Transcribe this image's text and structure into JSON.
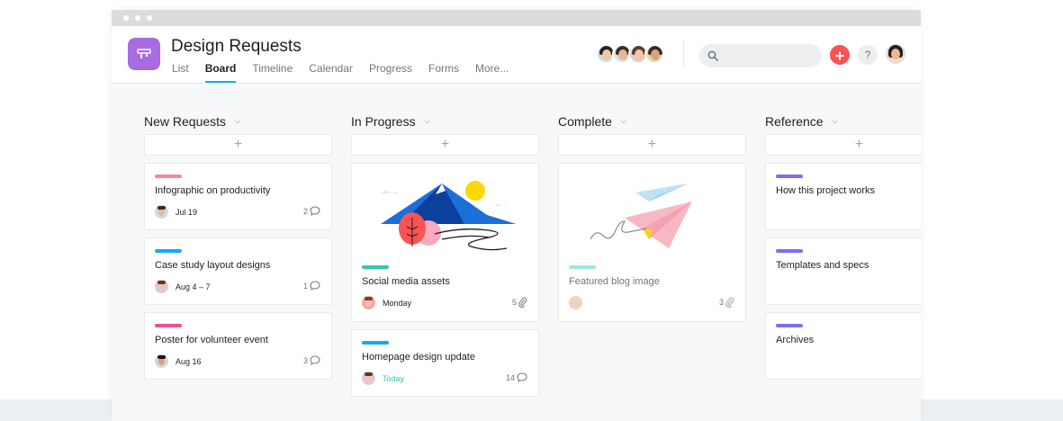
{
  "window": {
    "title": ""
  },
  "header": {
    "title": "Design Requests",
    "tabs": [
      {
        "label": "List",
        "active": false
      },
      {
        "label": "Board",
        "active": true
      },
      {
        "label": "Timeline",
        "active": false
      },
      {
        "label": "Calendar",
        "active": false
      },
      {
        "label": "Progress",
        "active": false
      },
      {
        "label": "Forms",
        "active": false
      },
      {
        "label": "More..."
      }
    ],
    "search": {
      "placeholder": ""
    },
    "add_icon": "plus-icon",
    "help_label": "?",
    "accent": "#14aaf5",
    "project_color": "#a86be0"
  },
  "columns": [
    {
      "title": "New Requests",
      "add_label": "+",
      "cards": [
        {
          "title": "Infographic on productivity",
          "date": "Jul 19",
          "count": "2",
          "count_icon": "comment-icon",
          "tag_color": "#f2899e"
        },
        {
          "title": "Case study layout designs",
          "date": "Aug 4 – 7",
          "count": "1",
          "count_icon": "comment-icon",
          "tag_color": "#14aaf5"
        },
        {
          "title": "Poster for volunteer event",
          "date": "Aug 16",
          "count": "3",
          "count_icon": "comment-icon",
          "tag_color": "#ea4e9d"
        }
      ]
    },
    {
      "title": "In Progress",
      "add_label": "+",
      "cards": [
        {
          "title": "Social media assets",
          "date": "Monday",
          "count": "5",
          "count_icon": "attachment-icon",
          "tag_color": "#37c5ab",
          "image": "mountain-illustration"
        },
        {
          "title": "Homepage design update",
          "date": "Today",
          "date_color": "#37c5ab",
          "count": "14",
          "count_icon": "comment-icon",
          "tag_color": "#14aaf5"
        }
      ]
    },
    {
      "title": "Complete",
      "add_label": "+",
      "cards": [
        {
          "title": "Featured blog image",
          "date": "",
          "count": "3",
          "count_icon": "attachment-icon",
          "tag_color": "#9ee7e3",
          "image": "paper-plane-illustration"
        }
      ]
    },
    {
      "title": "Reference",
      "add_label": "+",
      "cards": [
        {
          "title": "How this project works",
          "tag_color": "#7a6ff0"
        },
        {
          "title": "Templates and specs",
          "tag_color": "#7a6ff0"
        },
        {
          "title": "Archives",
          "tag_color": "#7a6ff0"
        }
      ]
    }
  ]
}
